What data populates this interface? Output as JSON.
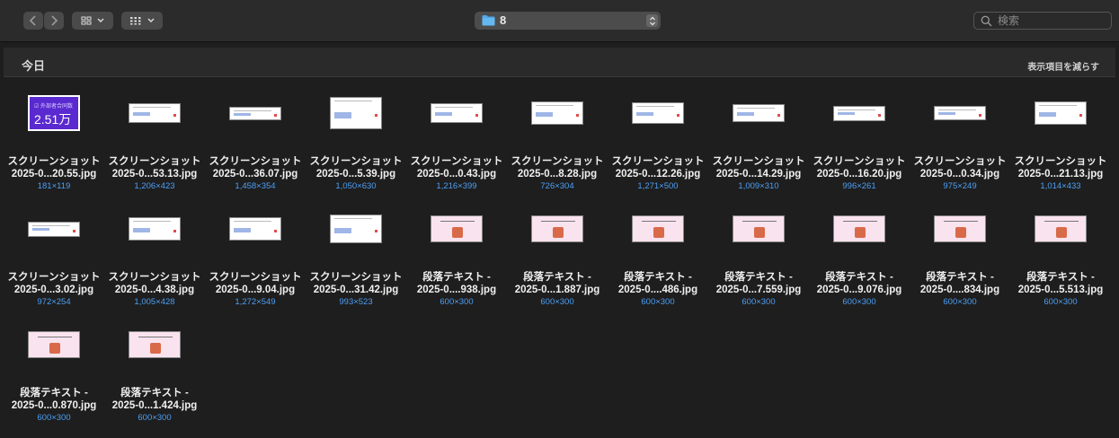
{
  "toolbar": {
    "path_label": "8",
    "search_placeholder": "検索"
  },
  "section": {
    "title": "今日",
    "collapse_link": "表示項目を減らす"
  },
  "thumbnail_text": {
    "stat_label": "☑ 外部者合同数",
    "stat_value": "2.51万"
  },
  "files": [
    {
      "line1": "スクリーンショット",
      "line2": "2025-0...20.55.jpg",
      "dims": "181×119",
      "style": "purple"
    },
    {
      "line1": "スクリーンショット",
      "line2": "2025-0...53.13.jpg",
      "dims": "1,206×423",
      "style": "white"
    },
    {
      "line1": "スクリーンショット",
      "line2": "2025-0...36.07.jpg",
      "dims": "1,458×354",
      "style": "white"
    },
    {
      "line1": "スクリーンショット",
      "line2": "2025-0...5.39.jpg",
      "dims": "1,050×630",
      "style": "white"
    },
    {
      "line1": "スクリーンショット",
      "line2": "2025-0...0.43.jpg",
      "dims": "1,216×399",
      "style": "white"
    },
    {
      "line1": "スクリーンショット",
      "line2": "2025-0...8.28.jpg",
      "dims": "726×304",
      "style": "white"
    },
    {
      "line1": "スクリーンショット",
      "line2": "2025-0...12.26.jpg",
      "dims": "1,271×500",
      "style": "white"
    },
    {
      "line1": "スクリーンショット",
      "line2": "2025-0...14.29.jpg",
      "dims": "1,009×310",
      "style": "white"
    },
    {
      "line1": "スクリーンショット",
      "line2": "2025-0...16.20.jpg",
      "dims": "996×261",
      "style": "white"
    },
    {
      "line1": "スクリーンショット",
      "line2": "2025-0...0.34.jpg",
      "dims": "975×249",
      "style": "white"
    },
    {
      "line1": "スクリーンショット",
      "line2": "2025-0...21.13.jpg",
      "dims": "1,014×433",
      "style": "white"
    },
    {
      "line1": "スクリーンショット",
      "line2": "2025-0...3.02.jpg",
      "dims": "972×254",
      "style": "white"
    },
    {
      "line1": "スクリーンショット",
      "line2": "2025-0...4.38.jpg",
      "dims": "1,005×428",
      "style": "white"
    },
    {
      "line1": "スクリーンショット",
      "line2": "2025-0...9.04.jpg",
      "dims": "1,272×549",
      "style": "white"
    },
    {
      "line1": "スクリーンショット",
      "line2": "2025-0...31.42.jpg",
      "dims": "993×523",
      "style": "white"
    },
    {
      "line1": "段落テキスト -",
      "line2": "2025-0....938.jpg",
      "dims": "600×300",
      "style": "pink"
    },
    {
      "line1": "段落テキスト -",
      "line2": "2025-0...1.887.jpg",
      "dims": "600×300",
      "style": "pink"
    },
    {
      "line1": "段落テキスト -",
      "line2": "2025-0....486.jpg",
      "dims": "600×300",
      "style": "pink"
    },
    {
      "line1": "段落テキスト -",
      "line2": "2025-0...7.559.jpg",
      "dims": "600×300",
      "style": "pink"
    },
    {
      "line1": "段落テキスト -",
      "line2": "2025-0...9.076.jpg",
      "dims": "600×300",
      "style": "pink"
    },
    {
      "line1": "段落テキスト -",
      "line2": "2025-0....834.jpg",
      "dims": "600×300",
      "style": "pink"
    },
    {
      "line1": "段落テキスト -",
      "line2": "2025-0...5.513.jpg",
      "dims": "600×300",
      "style": "pink"
    },
    {
      "line1": "段落テキスト -",
      "line2": "2025-0...0.870.jpg",
      "dims": "600×300",
      "style": "pink"
    },
    {
      "line1": "段落テキスト -",
      "line2": "2025-0...1.424.jpg",
      "dims": "600×300",
      "style": "pink"
    }
  ]
}
